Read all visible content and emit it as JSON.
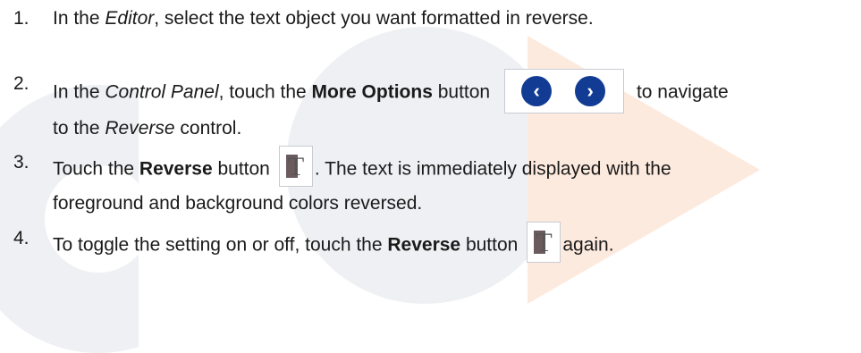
{
  "steps": [
    {
      "number": "1.",
      "parts": [
        "In the ",
        "Editor",
        ", select the text object you want formatted in reverse."
      ]
    },
    {
      "number": "2.",
      "parts": [
        "In the ",
        "Control Panel",
        ", touch the ",
        "More Options",
        " button",
        " to navigate",
        "to the ",
        "Reverse",
        " control."
      ]
    },
    {
      "number": "3.",
      "parts": [
        "Touch the ",
        "Reverse",
        " button",
        ". The text is immediately displayed with the",
        "foreground and background colors reversed."
      ]
    },
    {
      "number": "4.",
      "parts": [
        "To toggle the setting on or off, touch the ",
        "Reverse",
        " button",
        "again."
      ]
    }
  ],
  "icons": {
    "prev": "chevron-left-icon",
    "next": "chevron-right-icon",
    "reverse": "reverse-text-icon"
  },
  "colors": {
    "nav_button": "#123c93",
    "reverse_icon_fill": "#6b5b5f"
  }
}
